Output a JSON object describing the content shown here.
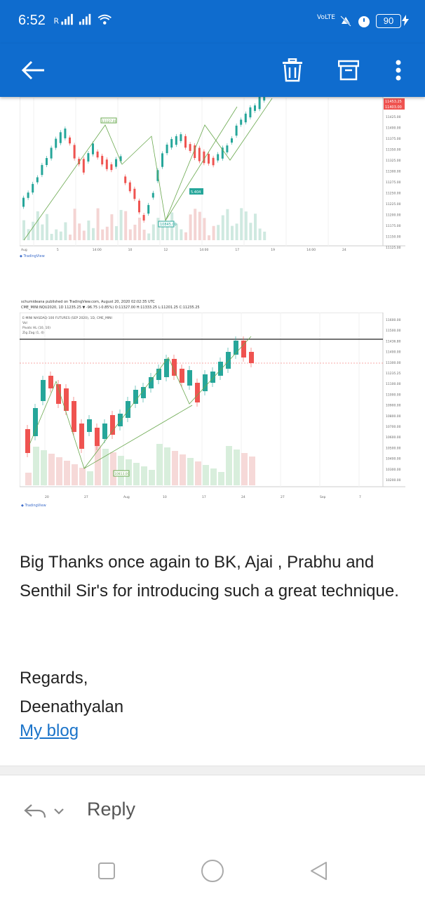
{
  "status": {
    "time": "6:52",
    "network_label": "VoLTE",
    "battery": "90"
  },
  "appbar": {
    "back_icon": "arrow-left-icon",
    "delete_icon": "trash-icon",
    "archive_icon": "archive-icon",
    "more_icon": "more-vertical-icon"
  },
  "chart1": {
    "price_labels": [
      "11425.00",
      "11400.00",
      "11375.00",
      "11350.00",
      "11325.00",
      "11300.00",
      "11275.00",
      "11250.00",
      "11225.00",
      "11200.00",
      "11175.00",
      "11150.00",
      "11125.00",
      "11100.00"
    ],
    "x_labels": [
      "Aug",
      "5",
      "14:00",
      "10",
      "12",
      "14:00",
      "17",
      "19",
      "14:00",
      "24"
    ],
    "badge_a": "11453.25",
    "badge_b": "11403.00",
    "mid_label": "5.404",
    "low_label": "10845.00",
    "top_label": "11127.00",
    "watermark": "TradingView"
  },
  "chart2": {
    "header_line1": "schumideana published on TradingView.com, August 20, 2020 02:02:35 UTC",
    "header_line2": "CME_MINI:NQU2020, 1D 11235.25 ▼ -96.75 (-0.85%) O:11327.00 H:11333.25 L:11201.25 C:11235.25",
    "legend_title": "E-MINI NASDAQ-100 FUTURES (SEP 2020), 1D, CME_MINI",
    "legend_vol": "Vol",
    "legend_pivots": "Pivots HL (10, 10)",
    "legend_zz": "Zig Zag (1, 4)",
    "price_labels": [
      "11600.00",
      "11500.00",
      "11436.80",
      "11400.00",
      "11300.00",
      "11235.25",
      "11100.00",
      "11000.00",
      "10900.00",
      "10800.00",
      "10700.00",
      "10600.00",
      "10500.00",
      "10400.00",
      "10300.00",
      "10200.00"
    ],
    "x_labels": [
      "20",
      "27",
      "Aug",
      "10",
      "17",
      "24",
      "27",
      "Sep",
      "7"
    ],
    "low_label": "10813.00",
    "watermark": "TradingView"
  },
  "message": {
    "body": "Big Thanks once again to BK, Ajai , Prabhu and Senthil Sir's for introducing such a great technique.",
    "regards": "Regards,",
    "name": "Deenathyalan",
    "link": "My blog"
  },
  "reply": {
    "label": "Reply",
    "reply_icon": "reply-icon",
    "chevron_icon": "chevron-down-icon"
  },
  "nav": {
    "recent_icon": "square-icon",
    "home_icon": "circle-icon",
    "back_icon": "triangle-back-icon"
  },
  "colors": {
    "appbar": "#0f6cce",
    "link": "#1a73c9",
    "up": "#26a69a",
    "down": "#ef5350"
  }
}
